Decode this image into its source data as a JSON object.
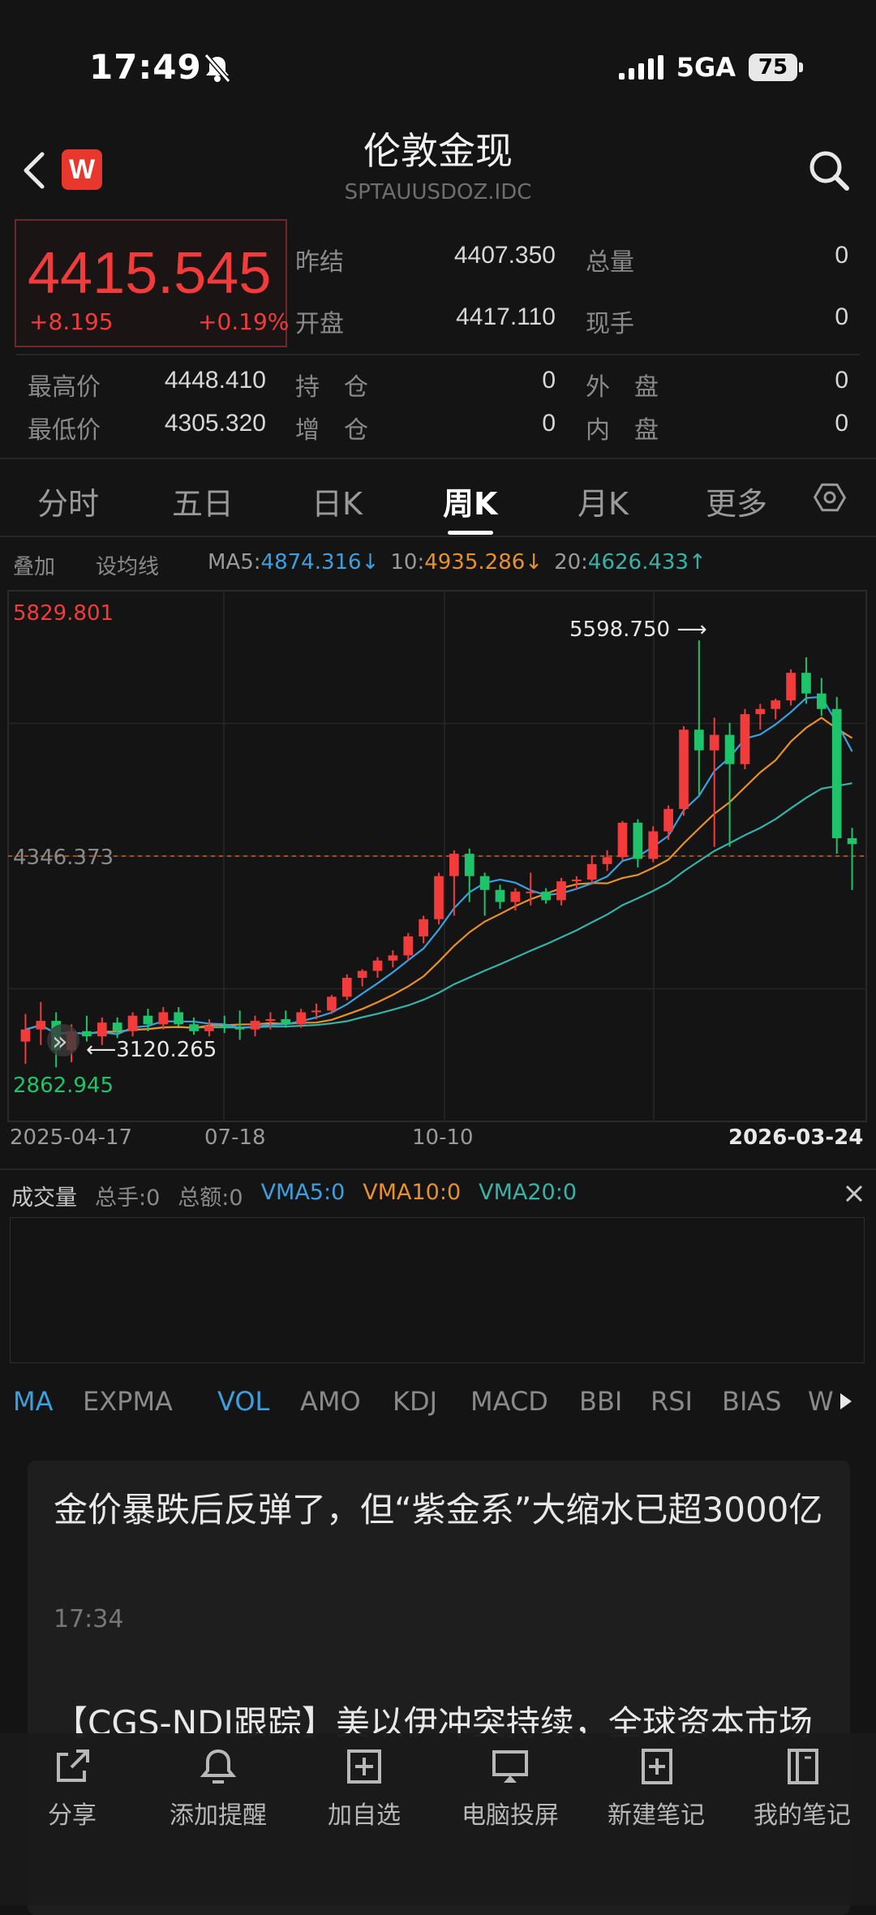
{
  "status": {
    "time": "17:49",
    "network": "5GA",
    "battery": "75"
  },
  "header": {
    "title": "伦敦金现",
    "symbol": "SPTAUUSDOZ.IDC",
    "logo": "W"
  },
  "quote": {
    "price": "4415.545",
    "change": "+8.195",
    "change_pct": "+0.19%",
    "fields": [
      {
        "label": "昨结",
        "value": "4407.350"
      },
      {
        "label": "总量",
        "value": "0"
      },
      {
        "label": "开盘",
        "value": "4417.110"
      },
      {
        "label": "现手",
        "value": "0"
      },
      {
        "label": "最高价",
        "value": "4448.410"
      },
      {
        "label": "持　仓",
        "value": "0"
      },
      {
        "label": "外　盘",
        "value": "0"
      },
      {
        "label": "最低价",
        "value": "4305.320"
      },
      {
        "label": "增　仓",
        "value": "0"
      },
      {
        "label": "内　盘",
        "value": "0"
      }
    ]
  },
  "tabs": [
    "分时",
    "五日",
    "日K",
    "周K",
    "月K",
    "更多"
  ],
  "active_tab": "周K",
  "ma_bar": {
    "overlay": "叠加",
    "set_ma": "设均线",
    "ma5_label": "MA5:",
    "ma5_value": "4874.316↓",
    "ma10_label": "10:",
    "ma10_value": "4935.286↓",
    "ma20_label": "20:",
    "ma20_value": "4626.433↑"
  },
  "colors": {
    "up": "#f23c3c",
    "down": "#1fc36a",
    "ma5": "#3aa0e0",
    "ma10": "#e8902c",
    "ma20": "#36b3a8",
    "accent": "#3aa0e0"
  },
  "chart_data": {
    "type": "candlestick",
    "period": "weekly",
    "ylim": [
      2862.945,
      5829.801
    ],
    "y_top_label": "5829.801",
    "y_bottom_label": "2862.945",
    "y_ref_label": "4346.373",
    "y_ref": 4346.373,
    "high_annotation": "5598.750 ⟶",
    "low_annotation": "⟵3120.265",
    "x_ticks": [
      "2025-04-17",
      "07-18",
      "10-10",
      "2026-03-24"
    ],
    "candles": [
      {
        "o": 3270,
        "h": 3430,
        "l": 3140,
        "c": 3340
      },
      {
        "o": 3340,
        "h": 3500,
        "l": 3250,
        "c": 3390
      },
      {
        "o": 3390,
        "h": 3440,
        "l": 3120,
        "c": 3220
      },
      {
        "o": 3220,
        "h": 3370,
        "l": 3150,
        "c": 3330
      },
      {
        "o": 3330,
        "h": 3420,
        "l": 3270,
        "c": 3300
      },
      {
        "o": 3300,
        "h": 3410,
        "l": 3250,
        "c": 3380
      },
      {
        "o": 3380,
        "h": 3410,
        "l": 3290,
        "c": 3330
      },
      {
        "o": 3330,
        "h": 3440,
        "l": 3300,
        "c": 3420
      },
      {
        "o": 3420,
        "h": 3460,
        "l": 3330,
        "c": 3370
      },
      {
        "o": 3370,
        "h": 3470,
        "l": 3340,
        "c": 3440
      },
      {
        "o": 3440,
        "h": 3470,
        "l": 3360,
        "c": 3370
      },
      {
        "o": 3370,
        "h": 3410,
        "l": 3310,
        "c": 3330
      },
      {
        "o": 3330,
        "h": 3400,
        "l": 3300,
        "c": 3360
      },
      {
        "o": 3360,
        "h": 3420,
        "l": 3320,
        "c": 3350
      },
      {
        "o": 3350,
        "h": 3450,
        "l": 3280,
        "c": 3340
      },
      {
        "o": 3340,
        "h": 3420,
        "l": 3300,
        "c": 3390
      },
      {
        "o": 3390,
        "h": 3440,
        "l": 3340,
        "c": 3400
      },
      {
        "o": 3400,
        "h": 3450,
        "l": 3350,
        "c": 3370
      },
      {
        "o": 3370,
        "h": 3460,
        "l": 3350,
        "c": 3440
      },
      {
        "o": 3440,
        "h": 3490,
        "l": 3400,
        "c": 3450
      },
      {
        "o": 3450,
        "h": 3540,
        "l": 3430,
        "c": 3530
      },
      {
        "o": 3530,
        "h": 3660,
        "l": 3510,
        "c": 3640
      },
      {
        "o": 3640,
        "h": 3690,
        "l": 3590,
        "c": 3680
      },
      {
        "o": 3680,
        "h": 3760,
        "l": 3640,
        "c": 3740
      },
      {
        "o": 3740,
        "h": 3800,
        "l": 3700,
        "c": 3770
      },
      {
        "o": 3770,
        "h": 3900,
        "l": 3740,
        "c": 3880
      },
      {
        "o": 3880,
        "h": 4000,
        "l": 3840,
        "c": 3980
      },
      {
        "o": 3980,
        "h": 4250,
        "l": 3950,
        "c": 4230
      },
      {
        "o": 4230,
        "h": 4380,
        "l": 4000,
        "c": 4360
      },
      {
        "o": 4360,
        "h": 4390,
        "l": 4080,
        "c": 4230
      },
      {
        "o": 4230,
        "h": 4250,
        "l": 4000,
        "c": 4150
      },
      {
        "o": 4150,
        "h": 4180,
        "l": 4040,
        "c": 4080
      },
      {
        "o": 4080,
        "h": 4160,
        "l": 4030,
        "c": 4140
      },
      {
        "o": 4140,
        "h": 4250,
        "l": 4060,
        "c": 4140
      },
      {
        "o": 4140,
        "h": 4160,
        "l": 4070,
        "c": 4090
      },
      {
        "o": 4090,
        "h": 4220,
        "l": 4060,
        "c": 4200
      },
      {
        "o": 4200,
        "h": 4230,
        "l": 4150,
        "c": 4210
      },
      {
        "o": 4210,
        "h": 4350,
        "l": 4180,
        "c": 4300
      },
      {
        "o": 4300,
        "h": 4380,
        "l": 4260,
        "c": 4340
      },
      {
        "o": 4340,
        "h": 4550,
        "l": 4320,
        "c": 4540
      },
      {
        "o": 4540,
        "h": 4560,
        "l": 4280,
        "c": 4330
      },
      {
        "o": 4330,
        "h": 4520,
        "l": 4310,
        "c": 4490
      },
      {
        "o": 4490,
        "h": 4640,
        "l": 4440,
        "c": 4620
      },
      {
        "o": 4620,
        "h": 5100,
        "l": 4580,
        "c": 5080
      },
      {
        "o": 5080,
        "h": 5598.75,
        "l": 4700,
        "c": 4960
      },
      {
        "o": 4960,
        "h": 5150,
        "l": 4400,
        "c": 5050
      },
      {
        "o": 5050,
        "h": 5120,
        "l": 4400,
        "c": 4880
      },
      {
        "o": 4880,
        "h": 5200,
        "l": 4850,
        "c": 5170
      },
      {
        "o": 5170,
        "h": 5230,
        "l": 5080,
        "c": 5200
      },
      {
        "o": 5200,
        "h": 5260,
        "l": 5140,
        "c": 5250
      },
      {
        "o": 5250,
        "h": 5430,
        "l": 5220,
        "c": 5410
      },
      {
        "o": 5410,
        "h": 5500,
        "l": 5230,
        "c": 5290
      },
      {
        "o": 5290,
        "h": 5380,
        "l": 5160,
        "c": 5200
      },
      {
        "o": 5200,
        "h": 5270,
        "l": 4360,
        "c": 4450
      },
      {
        "o": 4450,
        "h": 4510,
        "l": 4150,
        "c": 4415.545
      }
    ],
    "ma5_series_label": "MA5",
    "ma10_series_label": "10",
    "ma20_series_label": "20"
  },
  "volume_bar": {
    "title": "成交量",
    "total_hands": "总手:0",
    "total_amount": "总额:0",
    "vma5": "VMA5:0",
    "vma10": "VMA10:0",
    "vma20": "VMA20:0"
  },
  "indicator_tabs": [
    "MA",
    "EXPMA",
    "VOL",
    "AMO",
    "KDJ",
    "MACD",
    "BBI",
    "RSI",
    "BIAS",
    "W"
  ],
  "news": {
    "title": "金价暴跌后反弹了，但“紫金系”大缩水已超3000亿",
    "time": "17:34",
    "body": "【CGS-NDI跟踪】美以伊冲突持续，全球资本市场"
  },
  "bottom_nav": [
    "分享",
    "添加提醒",
    "加自选",
    "电脑投屏",
    "新建笔记",
    "我的笔记"
  ]
}
